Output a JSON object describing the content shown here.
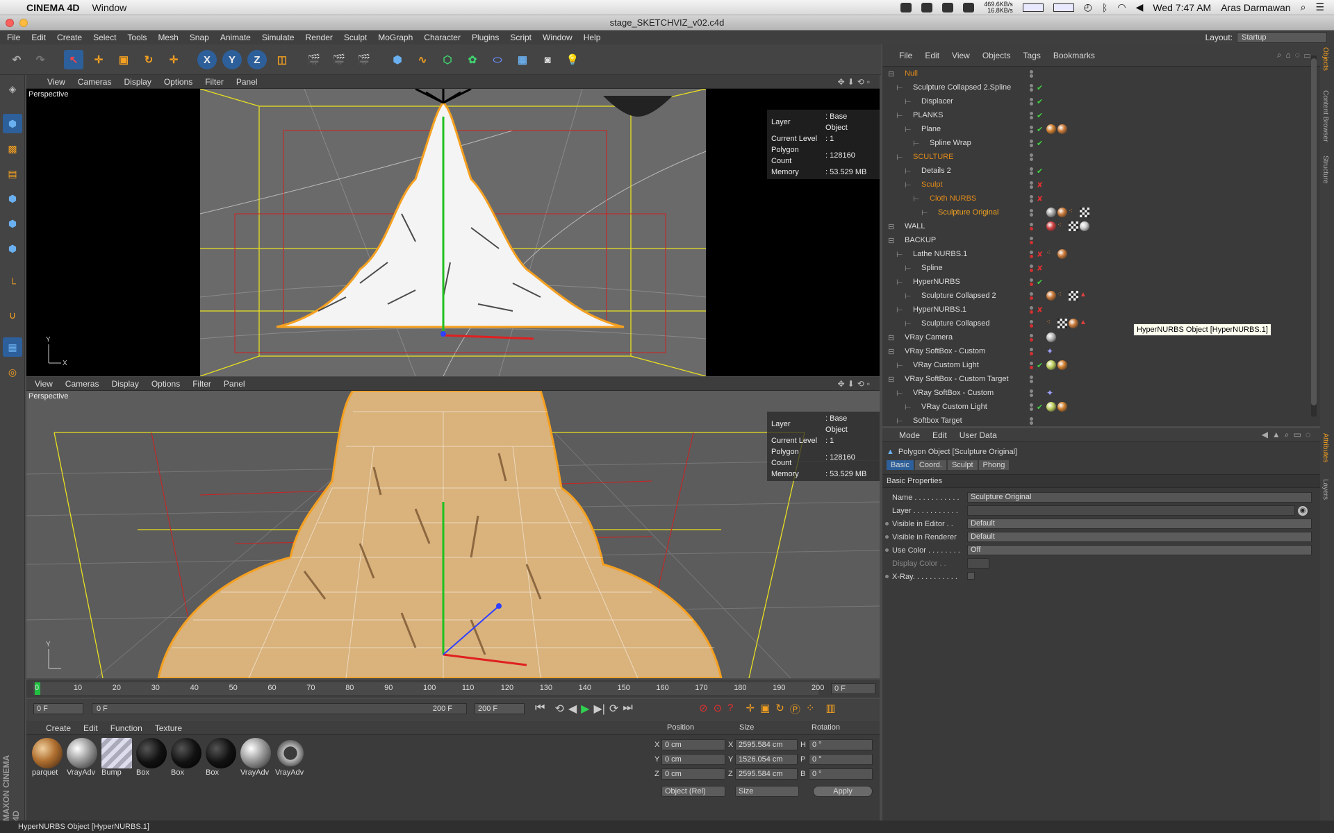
{
  "mac_menu": {
    "app": "CINEMA 4D",
    "window": "Window",
    "net_up": "469.6KB/s",
    "net_down": "16.8KB/s",
    "clock": "Wed 7:47 AM",
    "user": "Aras Darmawan"
  },
  "window_title": "stage_SKETCHVIZ_v02.c4d",
  "menus": [
    "File",
    "Edit",
    "Create",
    "Select",
    "Tools",
    "Mesh",
    "Snap",
    "Animate",
    "Simulate",
    "Render",
    "Sculpt",
    "MoGraph",
    "Character",
    "Plugins",
    "Script",
    "Window",
    "Help"
  ],
  "layout": {
    "label": "Layout:",
    "value": "Startup"
  },
  "viewport_top": {
    "menu": [
      "View",
      "Cameras",
      "Display",
      "Options",
      "Filter",
      "Panel"
    ],
    "label": "Perspective",
    "info": [
      {
        "k": "Layer",
        "v": ": Base Object"
      },
      {
        "k": "Current Level",
        "v": ": 1"
      },
      {
        "k": "Polygon Count",
        "v": ": 128160"
      },
      {
        "k": "Memory",
        "v": ": 53.529 MB"
      }
    ]
  },
  "viewport_bottom": {
    "menu": [
      "View",
      "Cameras",
      "Display",
      "Options",
      "Filter",
      "Panel"
    ],
    "label": "Perspective",
    "info": [
      {
        "k": "Layer",
        "v": ": Base Object"
      },
      {
        "k": "Current Level",
        "v": ": 1"
      },
      {
        "k": "Polygon Count",
        "v": ": 128160"
      },
      {
        "k": "Memory",
        "v": ": 53.529 MB"
      }
    ]
  },
  "objects_menu": [
    "File",
    "Edit",
    "View",
    "Objects",
    "Tags",
    "Bookmarks"
  ],
  "objects": [
    {
      "name": "Null",
      "indent": 0,
      "color": "#e08a1a"
    },
    {
      "name": "Sculpture Collapsed 2.Spline",
      "indent": 1,
      "color": "#dcdcdc"
    },
    {
      "name": "Displacer",
      "indent": 2,
      "color": "#dcdcdc"
    },
    {
      "name": "PLANKS",
      "indent": 1,
      "color": "#dcdcdc"
    },
    {
      "name": "Plane",
      "indent": 2,
      "color": "#dcdcdc"
    },
    {
      "name": "Spline Wrap",
      "indent": 3,
      "color": "#dcdcdc"
    },
    {
      "name": "SCULTURE",
      "indent": 1,
      "color": "#e08a1a"
    },
    {
      "name": "Details 2",
      "indent": 2,
      "color": "#dcdcdc"
    },
    {
      "name": "Sculpt",
      "indent": 2,
      "color": "#e08a1a"
    },
    {
      "name": "Cloth NURBS",
      "indent": 3,
      "color": "#e08a1a"
    },
    {
      "name": "Sculpture Original",
      "indent": 4,
      "color": "#f0a020"
    },
    {
      "name": "WALL",
      "indent": 0,
      "color": "#dcdcdc"
    },
    {
      "name": "BACKUP",
      "indent": 0,
      "color": "#dcdcdc"
    },
    {
      "name": "Lathe NURBS.1",
      "indent": 1,
      "color": "#dcdcdc"
    },
    {
      "name": "Spline",
      "indent": 2,
      "color": "#dcdcdc"
    },
    {
      "name": "HyperNURBS",
      "indent": 1,
      "color": "#dcdcdc"
    },
    {
      "name": "Sculpture Collapsed 2",
      "indent": 2,
      "color": "#dcdcdc"
    },
    {
      "name": "HyperNURBS.1",
      "indent": 1,
      "color": "#dcdcdc"
    },
    {
      "name": "Sculpture Collapsed",
      "indent": 2,
      "color": "#dcdcdc"
    },
    {
      "name": "VRay Camera",
      "indent": 0,
      "color": "#dcdcdc"
    },
    {
      "name": "VRay SoftBox - Custom",
      "indent": 0,
      "color": "#dcdcdc"
    },
    {
      "name": "VRay Custom Light",
      "indent": 1,
      "color": "#dcdcdc"
    },
    {
      "name": "VRay SoftBox - Custom Target",
      "indent": 0,
      "color": "#dcdcdc"
    },
    {
      "name": "VRay SoftBox - Custom",
      "indent": 1,
      "color": "#dcdcdc"
    },
    {
      "name": "VRay Custom Light",
      "indent": 2,
      "color": "#dcdcdc"
    },
    {
      "name": "Softbox Target",
      "indent": 1,
      "color": "#dcdcdc"
    }
  ],
  "tooltip": "HyperNURBS Object [HyperNURBS.1]",
  "attr_menu": [
    "Mode",
    "Edit",
    "User Data"
  ],
  "attr_title": "Polygon Object [Sculpture Original]",
  "attr_tabs": [
    "Basic",
    "Coord.",
    "Sculpt",
    "Phong"
  ],
  "attr_section": "Basic Properties",
  "attr_rows": [
    {
      "label": "Name . . . . . . . . . . .",
      "value": "Sculpture Original"
    },
    {
      "label": "Layer . . . . . . . . . . .",
      "value": ""
    },
    {
      "label": "Visible in Editor . .",
      "value": "Default"
    },
    {
      "label": "Visible in Renderer",
      "value": "Default"
    },
    {
      "label": "Use Color . . . . . . . .",
      "value": "Off"
    },
    {
      "label": "Display Color . .",
      "value": ""
    },
    {
      "label": "X-Ray. . . . . . . . . . .",
      "value": ""
    }
  ],
  "timeline": {
    "ticks": [
      "0",
      "10",
      "20",
      "30",
      "40",
      "50",
      "60",
      "70",
      "80",
      "90",
      "100",
      "110",
      "120",
      "130",
      "140",
      "150",
      "160",
      "170",
      "180",
      "190",
      "200"
    ],
    "current": "0 F"
  },
  "playback": {
    "start": "0 F",
    "range_start": "0 F",
    "range_end": "200 F",
    "end": "200 F"
  },
  "material_menu": [
    "Create",
    "Edit",
    "Function",
    "Texture"
  ],
  "materials": [
    {
      "name": "parquet",
      "kind": "wood"
    },
    {
      "name": "VrayAdv",
      "kind": "grey"
    },
    {
      "name": "Bump",
      "kind": "stripe"
    },
    {
      "name": "Box",
      "kind": "black"
    },
    {
      "name": "Box",
      "kind": "black"
    },
    {
      "name": "Box",
      "kind": "black"
    },
    {
      "name": "VrayAdv",
      "kind": "grey"
    },
    {
      "name": "VrayAdv",
      "kind": "knot"
    }
  ],
  "coords": {
    "headers": [
      "Position",
      "Size",
      "Rotation"
    ],
    "rows": [
      {
        "axis": "X",
        "pos": "0 cm",
        "sax": "X",
        "size": "2595.584 cm",
        "rax": "H",
        "rot": "0 °"
      },
      {
        "axis": "Y",
        "pos": "0 cm",
        "sax": "Y",
        "size": "1526.054 cm",
        "rax": "P",
        "rot": "0 °"
      },
      {
        "axis": "Z",
        "pos": "0 cm",
        "sax": "Z",
        "size": "2595.584 cm",
        "rax": "B",
        "rot": "0 °"
      }
    ],
    "mode": "Object (Rel)",
    "size_mode": "Size",
    "apply": "Apply"
  },
  "status": "HyperNURBS Object [HyperNURBS.1]",
  "right_tabs": [
    "Objects",
    "Content Browser",
    "Structure"
  ],
  "right_tabs2": [
    "Attributes",
    "Layers"
  ],
  "brand": "MAXON CINEMA 4D"
}
